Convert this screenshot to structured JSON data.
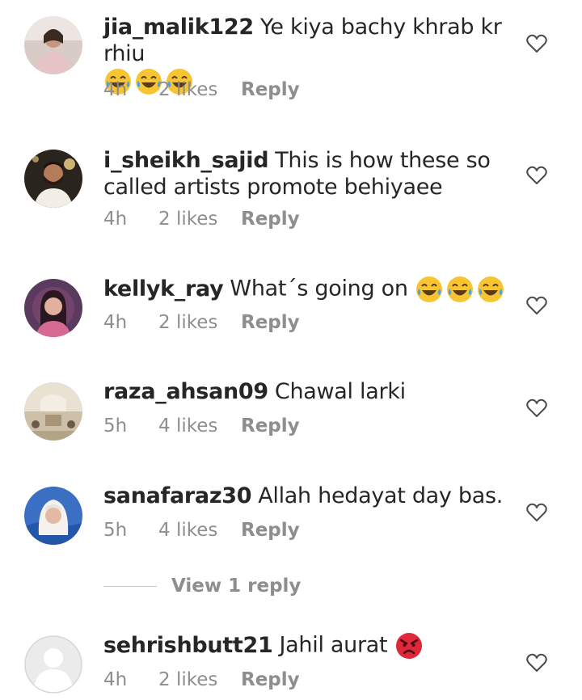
{
  "comments": [
    {
      "username": "jia_malik122",
      "text": "Ye kiya bachy khrab kr rhiu",
      "emoji": [
        "laughing-tears",
        "laughing-tears",
        "laughing-tears"
      ],
      "time": "4h",
      "likes": "2 likes",
      "reply": "Reply"
    },
    {
      "username": "i_sheikh_sajid",
      "text": "This is how these so called artists promote behiyaee",
      "emoji": [],
      "time": "4h",
      "likes": "2 likes",
      "reply": "Reply"
    },
    {
      "username": "kellyk_ray",
      "text": "What´s going on",
      "emoji": [
        "laughing-tears",
        "laughing-tears",
        "laughing-tears"
      ],
      "time": "4h",
      "likes": "2 likes",
      "reply": "Reply"
    },
    {
      "username": "raza_ahsan09",
      "text": "Chawal larki",
      "emoji": [],
      "time": "5h",
      "likes": "4 likes",
      "reply": "Reply"
    },
    {
      "username": "sanafaraz30",
      "text": "Allah hedayat day bas.",
      "emoji": [],
      "time": "5h",
      "likes": "4 likes",
      "reply": "Reply"
    },
    {
      "username": "sehrishbutt21",
      "text": "Jahil aurat",
      "emoji": [
        "angry-face"
      ],
      "time": "4h",
      "likes": "2 likes",
      "reply": "Reply"
    }
  ],
  "view_replies": "View 1 reply",
  "colors": {
    "text": "#262626",
    "meta": "#8e8e8e",
    "emoji_yellow": "#f7c531",
    "emoji_tear": "#4ba3e3",
    "angry_red": "#e0283b"
  }
}
